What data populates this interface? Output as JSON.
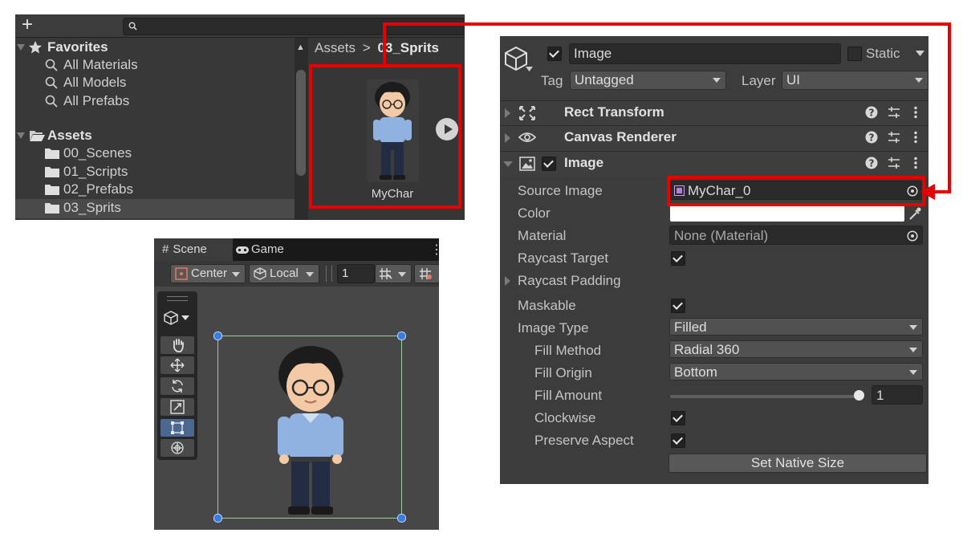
{
  "project": {
    "plus_label": "+",
    "tree": [
      {
        "label": "Favorites",
        "kind": "header",
        "icon": "star-icon"
      },
      {
        "label": "All Materials",
        "kind": "search",
        "icon": "search-icon"
      },
      {
        "label": "All Models",
        "kind": "search",
        "icon": "search-icon"
      },
      {
        "label": "All Prefabs",
        "kind": "search",
        "icon": "search-icon"
      },
      {
        "label": "Assets",
        "kind": "header",
        "icon": "folder-open-icon"
      },
      {
        "label": "00_Scenes",
        "kind": "folder",
        "icon": "folder-icon"
      },
      {
        "label": "01_Scripts",
        "kind": "folder",
        "icon": "folder-icon"
      },
      {
        "label": "02_Prefabs",
        "kind": "folder",
        "icon": "folder-icon"
      },
      {
        "label": "03_Sprits",
        "kind": "folder",
        "icon": "folder-icon",
        "selected": true
      }
    ],
    "breadcrumb": {
      "root": "Assets",
      "separator": ">",
      "current": "03_Sprits"
    },
    "asset": {
      "label": "MyChar"
    }
  },
  "scene": {
    "tab_scene": "Scene",
    "tab_game": "Game",
    "pivot_label": "Center",
    "space_label": "Local",
    "grid_value": "1"
  },
  "inspector": {
    "object_name": "Image",
    "static_label": "Static",
    "tag_label": "Tag",
    "tag_value": "Untagged",
    "layer_label": "Layer",
    "layer_value": "UI",
    "components": {
      "rect_transform": "Rect Transform",
      "canvas_renderer": "Canvas Renderer",
      "image": "Image"
    },
    "props": {
      "source_image_label": "Source Image",
      "source_image_value": "MyChar_0",
      "color_label": "Color",
      "material_label": "Material",
      "material_value": "None (Material)",
      "raycast_target_label": "Raycast Target",
      "raycast_padding_label": "Raycast Padding",
      "maskable_label": "Maskable",
      "image_type_label": "Image Type",
      "image_type_value": "Filled",
      "fill_method_label": "Fill Method",
      "fill_method_value": "Radial 360",
      "fill_origin_label": "Fill Origin",
      "fill_origin_value": "Bottom",
      "fill_amount_label": "Fill Amount",
      "fill_amount_value": "1",
      "clockwise_label": "Clockwise",
      "preserve_aspect_label": "Preserve Aspect",
      "set_native_size_label": "Set Native Size"
    }
  },
  "colors": {
    "annotation_red": "#e60000",
    "color_field": "#ffffff",
    "selection_rect": "#9bcc9b",
    "handle_blue": "#3b7be5"
  }
}
